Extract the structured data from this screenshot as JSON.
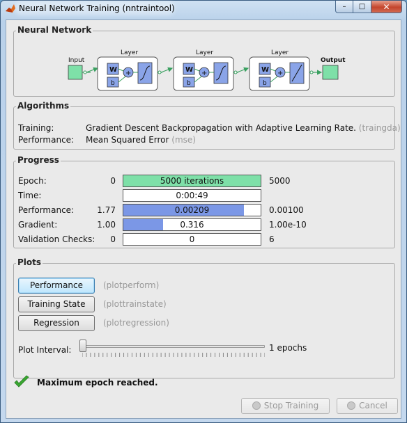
{
  "window": {
    "title": "Neural Network Training (nntraintool)",
    "minimize": "–",
    "maximize": "□",
    "close": "✕"
  },
  "network": {
    "section_title": "Neural Network",
    "input_label": "Input",
    "output_label": "Output",
    "layer_label": "Layer",
    "weight_label": "W",
    "bias_label": "b",
    "sum_symbol": "+",
    "layers": [
      {
        "label": "Layer",
        "transfer": "tansig"
      },
      {
        "label": "Layer",
        "transfer": "tansig"
      },
      {
        "label": "Layer",
        "transfer": "purelin"
      }
    ]
  },
  "algorithms": {
    "section_title": "Algorithms",
    "training_label": "Training:",
    "training_value": "Gradient Descent Backpropagation with Adaptive Learning Rate.",
    "training_fn": "(traingda)",
    "performance_label": "Performance:",
    "performance_value": "Mean Squared Error",
    "performance_fn": "(mse)"
  },
  "progress": {
    "section_title": "Progress",
    "rows": [
      {
        "label": "Epoch:",
        "start": "0",
        "value": "5000 iterations",
        "end": "5000",
        "fill": 1.0,
        "color": "green"
      },
      {
        "label": "Time:",
        "start": "",
        "value": "0:00:49",
        "end": "",
        "fill": 0.0,
        "color": "none"
      },
      {
        "label": "Performance:",
        "start": "1.77",
        "value": "0.00209",
        "end": "0.00100",
        "fill": 0.88,
        "color": "blue"
      },
      {
        "label": "Gradient:",
        "start": "1.00",
        "value": "0.316",
        "end": "1.00e-10",
        "fill": 0.29,
        "color": "blue"
      },
      {
        "label": "Validation Checks:",
        "start": "0",
        "value": "0",
        "end": "6",
        "fill": 0.0,
        "color": "none"
      }
    ]
  },
  "plots": {
    "section_title": "Plots",
    "buttons": [
      {
        "label": "Performance",
        "fn": "(plotperform)"
      },
      {
        "label": "Training State",
        "fn": "(plottrainstate)"
      },
      {
        "label": "Regression",
        "fn": "(plotregression)"
      }
    ],
    "interval_label": "Plot Interval:",
    "interval_value": "1 epochs",
    "interval_fraction": 0.0
  },
  "status": {
    "message": "Maximum epoch reached."
  },
  "footer": {
    "stop_label": "Stop Training",
    "cancel_label": "Cancel"
  },
  "colors": {
    "io_box": "#7ee0a8",
    "layer_block": "#8aa4e8",
    "progress_green": "#7ee0a8",
    "progress_blue": "#7b97e6",
    "check_green": "#3aa832"
  }
}
